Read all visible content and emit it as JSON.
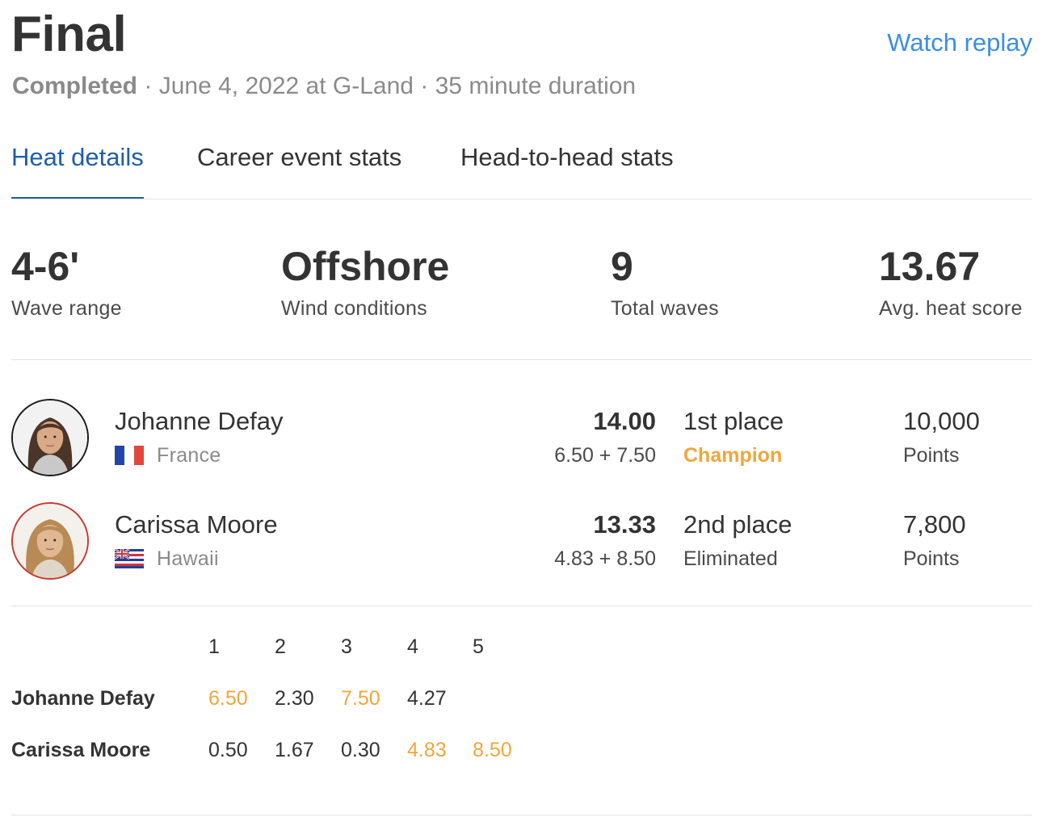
{
  "header": {
    "title": "Final",
    "watch_replay": "Watch replay",
    "status": "Completed",
    "separator": "·",
    "date_location": "June 4, 2022 at G-Land",
    "duration": "35 minute duration"
  },
  "tabs": [
    {
      "label": "Heat details",
      "active": true
    },
    {
      "label": "Career event stats",
      "active": false
    },
    {
      "label": "Head-to-head stats",
      "active": false
    }
  ],
  "stats": [
    {
      "value": "4-6'",
      "label": "Wave range"
    },
    {
      "value": "Offshore",
      "label": "Wind conditions"
    },
    {
      "value": "9",
      "label": "Total waves"
    },
    {
      "value": "13.67",
      "label": "Avg. heat score"
    }
  ],
  "athletes": [
    {
      "name": "Johanne Defay",
      "country": "France",
      "total": "14.00",
      "breakdown": "6.50 + 7.50",
      "place": "1st place",
      "outcome": "Champion",
      "points": "10,000",
      "points_label": "Points"
    },
    {
      "name": "Carissa Moore",
      "country": "Hawaii",
      "total": "13.33",
      "breakdown": "4.83 + 8.50",
      "place": "2nd place",
      "outcome": "Eliminated",
      "points": "7,800",
      "points_label": "Points"
    }
  ],
  "waves": {
    "headers": [
      "1",
      "2",
      "3",
      "4",
      "5"
    ],
    "rows": [
      {
        "name": "Johanne Defay",
        "scores": [
          "6.50",
          "2.30",
          "7.50",
          "4.27"
        ],
        "counting": [
          0,
          2
        ]
      },
      {
        "name": "Carissa Moore",
        "scores": [
          "0.50",
          "1.67",
          "0.30",
          "4.83",
          "8.50"
        ],
        "counting": [
          3,
          4
        ]
      }
    ]
  },
  "colors": {
    "link": "#3b8fe0",
    "active_tab": "#1e5ea8",
    "highlight": "#f0a73a",
    "muted": "#8a8a8a"
  },
  "icons": {
    "flag_france": "france-flag-icon",
    "flag_hawaii": "hawaii-flag-icon"
  }
}
